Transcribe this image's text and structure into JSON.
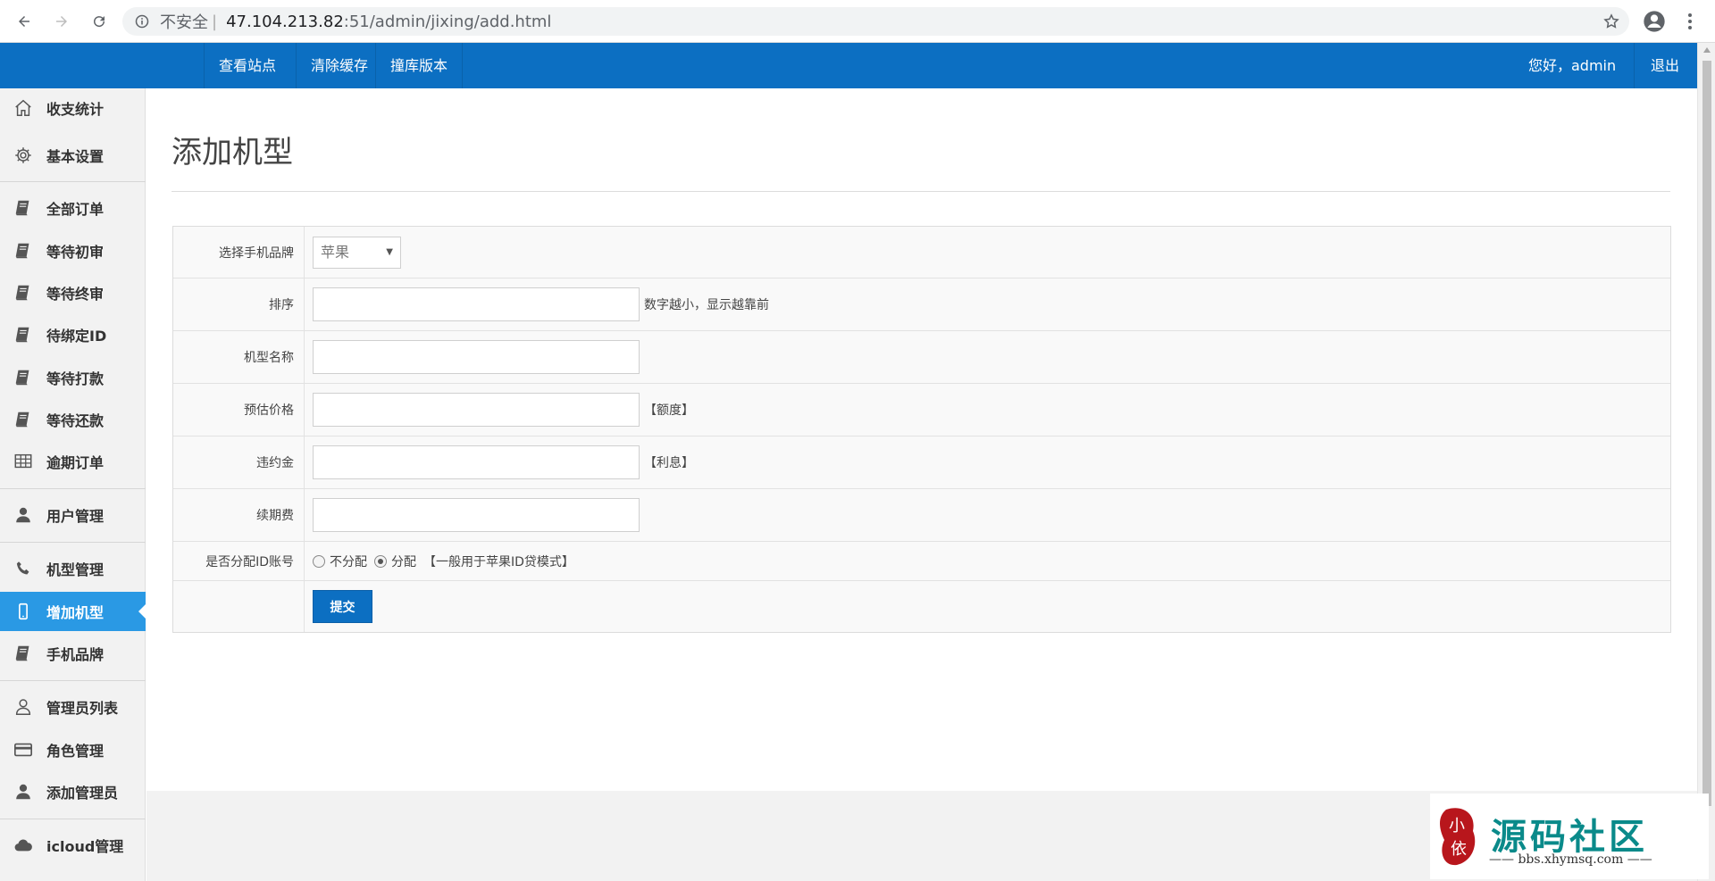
{
  "browser": {
    "insecure_label": "不安全",
    "url_host": "47.104.213.82",
    "url_path": ":51/admin/jixing/add.html"
  },
  "topbar": {
    "links": [
      "查看站点",
      "清除缓存",
      "撞库版本"
    ],
    "greeting": "您好，admin",
    "logout": "退出"
  },
  "sidebar": {
    "items": [
      {
        "label": "收支统计",
        "icon": "home-icon"
      },
      {
        "label": "基本设置",
        "icon": "gear-icon"
      },
      {
        "label": "全部订单",
        "icon": "book-icon"
      },
      {
        "label": "等待初审",
        "icon": "book-icon"
      },
      {
        "label": "等待终审",
        "icon": "book-icon"
      },
      {
        "label": "待绑定ID",
        "icon": "book-icon"
      },
      {
        "label": "等待打款",
        "icon": "book-icon"
      },
      {
        "label": "等待还款",
        "icon": "book-icon"
      },
      {
        "label": "逾期订单",
        "icon": "table-icon"
      },
      {
        "label": "用户管理",
        "icon": "user-icon"
      },
      {
        "label": "机型管理",
        "icon": "phone-icon"
      },
      {
        "label": "增加机型",
        "icon": "mobile-icon",
        "active": true
      },
      {
        "label": "手机品牌",
        "icon": "book-icon"
      },
      {
        "label": "管理员列表",
        "icon": "user-outline-icon"
      },
      {
        "label": "角色管理",
        "icon": "card-icon"
      },
      {
        "label": "添加管理员",
        "icon": "user-icon"
      },
      {
        "label": "icloud管理",
        "icon": "cloud-icon"
      }
    ]
  },
  "page": {
    "title": "添加机型"
  },
  "form": {
    "brand_label": "选择手机品牌",
    "brand_value": "苹果",
    "sort_label": "排序",
    "sort_hint": "数字越小，显示越靠前",
    "model_label": "机型名称",
    "price_label": "预估价格",
    "price_hint": "【额度】",
    "penalty_label": "违约金",
    "penalty_hint": "【利息】",
    "renewal_label": "续期费",
    "assign_label": "是否分配ID账号",
    "assign_no": "不分配",
    "assign_yes": "分配",
    "assign_hint": "【一般用于苹果ID贷模式】",
    "submit": "提交"
  },
  "watermark": {
    "seal_text": "小依",
    "title": "源码社区",
    "sub": "—— bbs.xhymsq.com ——"
  }
}
